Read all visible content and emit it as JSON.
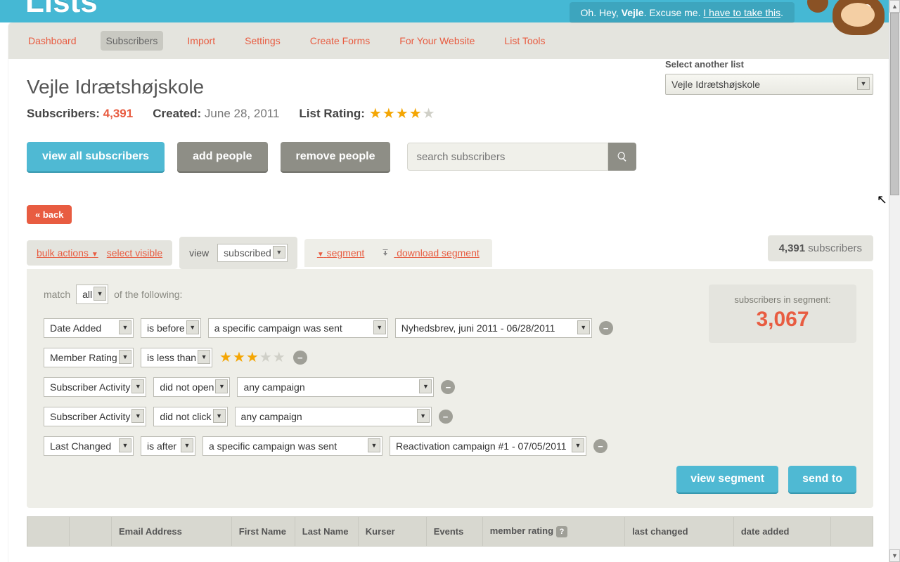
{
  "banner": {
    "greeting_pre": "Oh. Hey, ",
    "greeting_name": "Vejle",
    "greeting_mid": ". Excuse me. ",
    "greeting_link": "I have to take this",
    "title": "Lists"
  },
  "nav": {
    "items": [
      "Dashboard",
      "Subscribers",
      "Import",
      "Settings",
      "Create Forms",
      "For Your Website",
      "List Tools"
    ],
    "active": "Subscribers"
  },
  "list": {
    "name": "Vejle Idrætshøjskole",
    "subscribers_label": "Subscribers:",
    "subscribers_count": "4,391",
    "created_label": "Created:",
    "created_date": "June 28, 2011",
    "rating_label": "List Rating:",
    "rating_stars": 4
  },
  "list_switch": {
    "label": "Select another list",
    "selected": "Vejle Idrætshøjskole"
  },
  "actions": {
    "view_all": "view all subscribers",
    "add": "add people",
    "remove": "remove people",
    "search_placeholder": "search subscribers"
  },
  "back_label": "« back",
  "toolbar": {
    "bulk_actions": "bulk actions",
    "select_visible": "select visible",
    "view_label": "view",
    "view_value": "subscribed",
    "segment": "segment",
    "download": "download segment",
    "total_count": "4,391",
    "total_label": "subscribers"
  },
  "segment": {
    "match_pre": "match",
    "match_value": "all",
    "match_post": "of the following:",
    "in_segment_label": "subscribers in segment:",
    "in_segment_count": "3,067",
    "view_btn": "view segment",
    "send_btn": "send to",
    "rows": [
      {
        "field": "Date Added",
        "op": "is before",
        "val1": "a specific campaign was sent",
        "val2": "Nyhedsbrev, juni 2011 - 06/28/2011"
      },
      {
        "field": "Member Rating",
        "op": "is less than",
        "stars": 3
      },
      {
        "field": "Subscriber Activity",
        "op": "did not open",
        "val1": "any campaign"
      },
      {
        "field": "Subscriber Activity",
        "op": "did not click",
        "val1": "any campaign"
      },
      {
        "field": "Last Changed",
        "op": "is after",
        "val1": "a specific campaign was sent",
        "val2": "Reactivation campaign #1 - 07/05/2011"
      }
    ]
  },
  "table": {
    "headers": [
      "",
      "",
      "Email Address",
      "First Name",
      "Last Name",
      "Kurser",
      "Events",
      "member rating",
      "last changed",
      "date added",
      ""
    ]
  }
}
